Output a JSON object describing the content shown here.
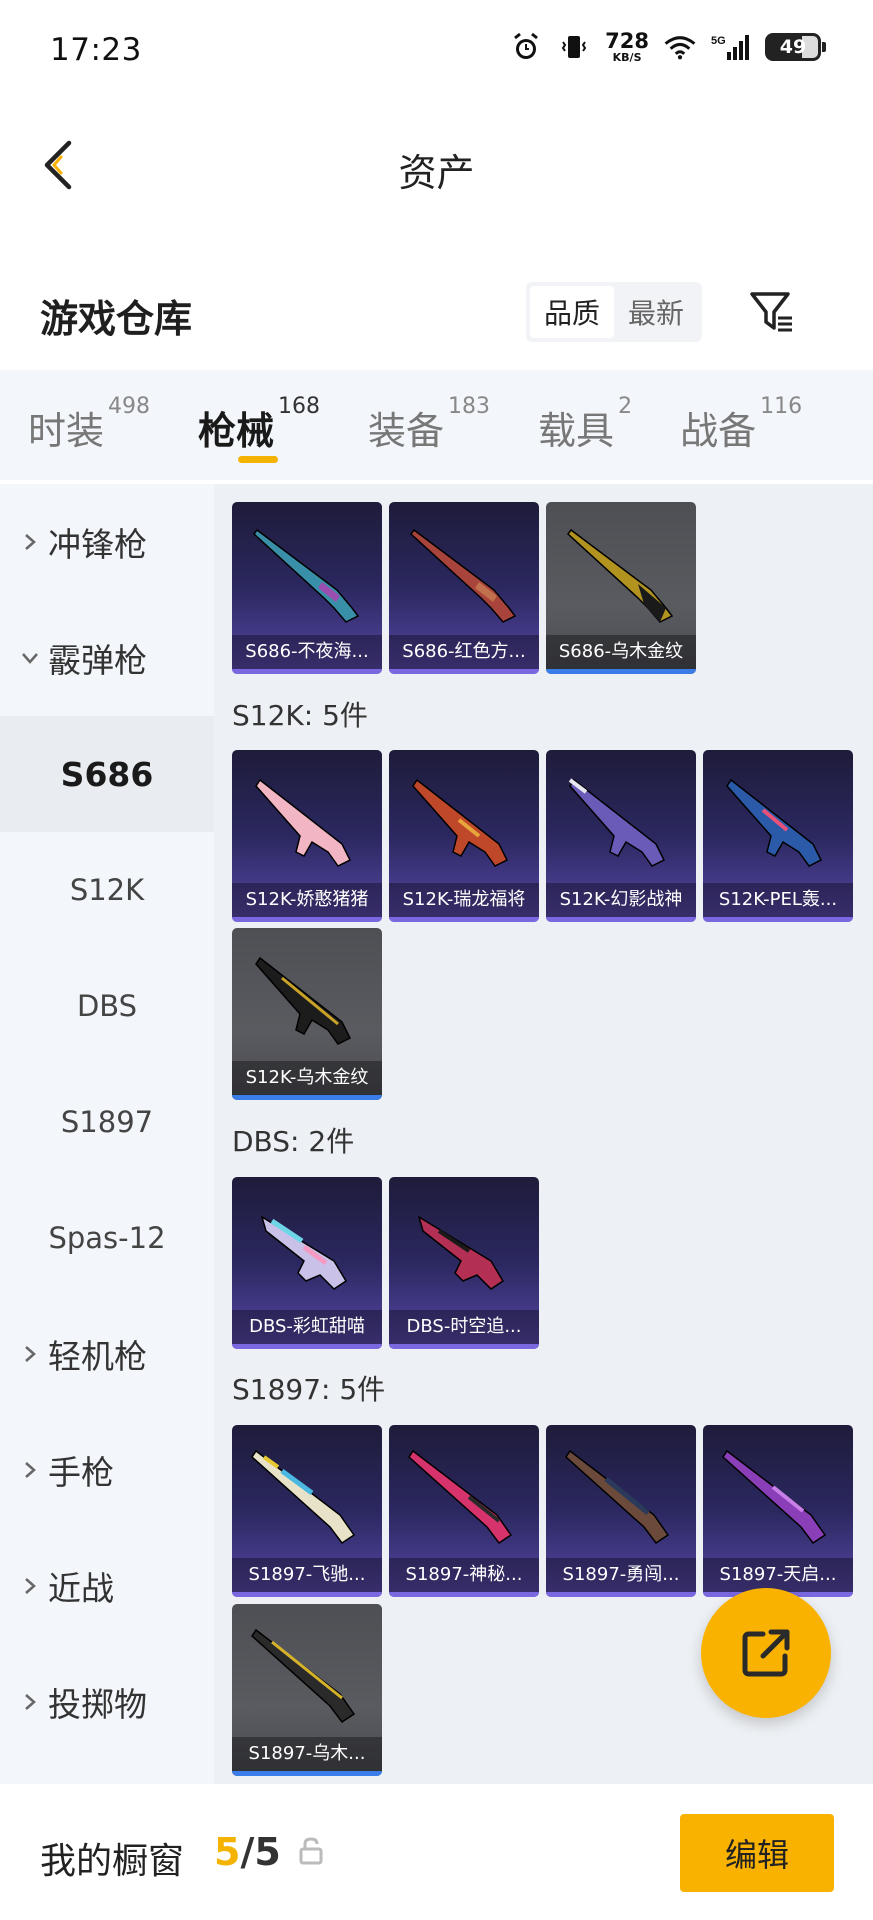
{
  "status_bar": {
    "time": "17:23",
    "net_speed_value": "728",
    "net_speed_unit": "KB/S",
    "network_type": "5G",
    "battery_level": "49"
  },
  "header": {
    "title": "资产"
  },
  "warehouse": {
    "title": "游戏仓库",
    "sort_options": [
      "品质",
      "最新"
    ],
    "active_sort": "品质"
  },
  "tabs": [
    {
      "label": "时装",
      "count": "498"
    },
    {
      "label": "枪械",
      "count": "168",
      "active": true
    },
    {
      "label": "装备",
      "count": "183"
    },
    {
      "label": "载具",
      "count": "2"
    },
    {
      "label": "战备",
      "count": "116"
    }
  ],
  "sidenav": {
    "categories": [
      "冲锋枪",
      "霰弹枪",
      "轻机枪",
      "手枪",
      "近战",
      "投掷物"
    ],
    "subitems": [
      "S686",
      "S12K",
      "DBS",
      "S1897",
      "Spas-12"
    ],
    "selected": "S686"
  },
  "content": {
    "sections": [
      {
        "title": "",
        "items": [
          "S686-不夜海...",
          "S686-红色方...",
          "S686-乌木金纹"
        ]
      },
      {
        "title": "S12K: 5件",
        "items": [
          "S12K-娇憨猪猪",
          "S12K-瑞龙福将",
          "S12K-幻影战神",
          "S12K-PEL轰...",
          "S12K-乌木金纹"
        ]
      },
      {
        "title": "DBS: 2件",
        "items": [
          "DBS-彩虹甜喵",
          "DBS-时空追..."
        ]
      },
      {
        "title": "S1897: 5件",
        "items": [
          "S1897-飞驰...",
          "S1897-神秘...",
          "S1897-勇闯...",
          "S1897-天启...",
          "S1897-乌木..."
        ]
      }
    ]
  },
  "bottom_bar": {
    "showcase_label": "我的橱窗",
    "current": "5",
    "separator": "/",
    "max": "5",
    "edit_label": "编辑"
  },
  "colors": {
    "accent": "#f9b200",
    "purple_card": "#2b2860",
    "gray_card": "#55565b"
  },
  "icons": {
    "back": "chevron-left-icon",
    "filter": "filter-icon",
    "fab": "share-external-icon",
    "lock": "lock-icon"
  }
}
